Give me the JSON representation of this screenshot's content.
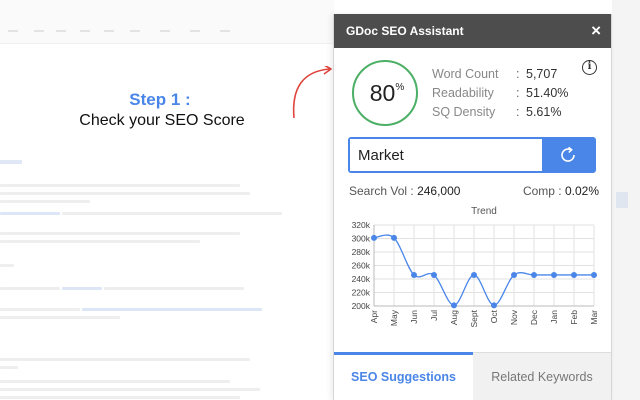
{
  "callout": {
    "title": "Step 1 :",
    "description": "Check your SEO Score"
  },
  "panel": {
    "title": "GDoc SEO Assistant",
    "close_label": "×"
  },
  "score": {
    "value": "80",
    "unit": "%",
    "color": "#4caf66"
  },
  "metrics": [
    {
      "label": "Word Count",
      "value": "5,707"
    },
    {
      "label": "Readability",
      "value": "51.40%"
    },
    {
      "label": "SQ  Density",
      "value": "5.61%"
    }
  ],
  "info_icon": "info-icon",
  "search": {
    "value": "Market",
    "button_icon": "refresh-icon"
  },
  "keyword_stats": {
    "volume_label": "Search Vol :",
    "volume_value": "246,000",
    "comp_label": "Comp :",
    "comp_value": "0.02%"
  },
  "chart_data": {
    "type": "line",
    "title": "Trend",
    "categories": [
      "Apr",
      "May",
      "Jun",
      "Jul",
      "Aug",
      "Sept",
      "Oct",
      "Nov",
      "Dec",
      "Jan",
      "Feb",
      "Mar"
    ],
    "values": [
      301000,
      301000,
      246000,
      246000,
      201000,
      246000,
      201000,
      246000,
      246000,
      246000,
      246000,
      246000
    ],
    "y_ticks": [
      "200k",
      "220k",
      "240k",
      "260k",
      "280k",
      "300k",
      "320k"
    ],
    "ylim": [
      200000,
      320000
    ],
    "grid": true,
    "smooth": true,
    "color": "#4a86e8"
  },
  "tabs": [
    {
      "label": "SEO Suggestions",
      "active": true
    },
    {
      "label": "Related Keywords",
      "active": false
    }
  ],
  "colors": {
    "accent": "#4a86e8",
    "header": "#4d4d4d",
    "arrow": "#e0443c"
  }
}
